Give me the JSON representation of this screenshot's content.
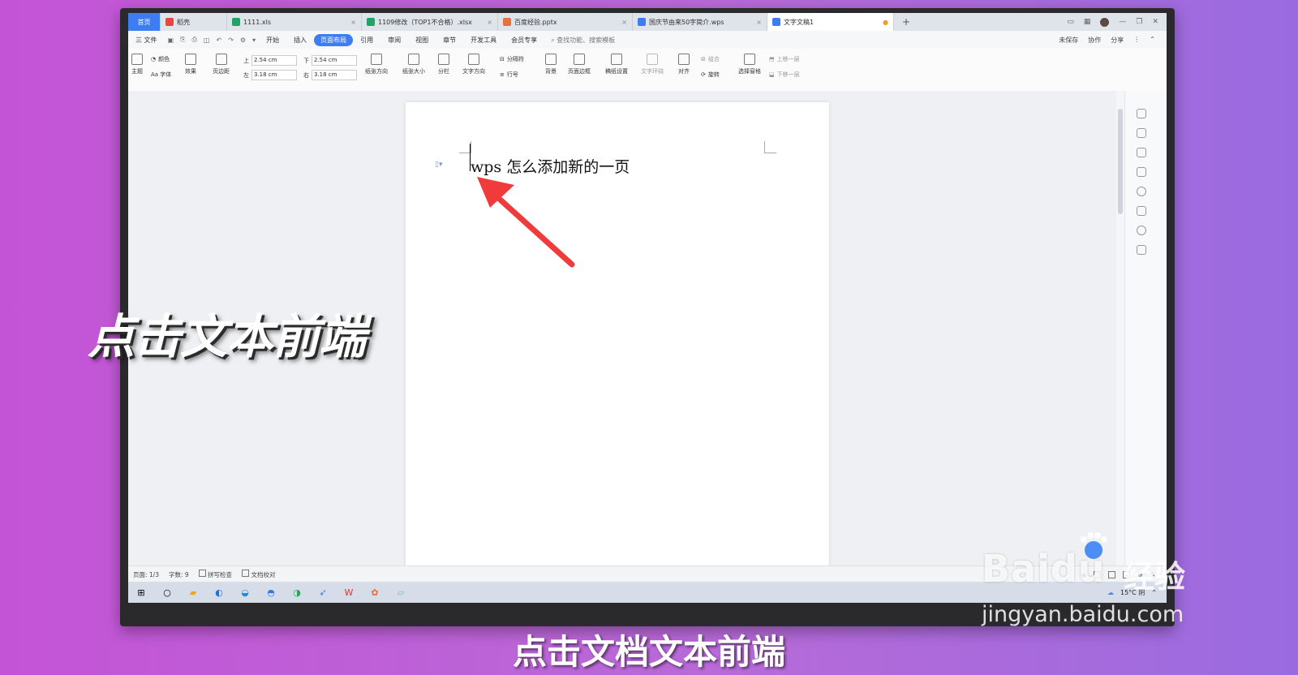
{
  "tabs": [
    {
      "label": "首页",
      "kind": "home"
    },
    {
      "label": "稻壳",
      "color": "#e8453c"
    },
    {
      "label": "1111.xls",
      "color": "#1fa463"
    },
    {
      "label": "1109修改（TOP1不合格）.xlsx",
      "color": "#1fa463"
    },
    {
      "label": "百度经验.pptx",
      "color": "#e8703c"
    },
    {
      "label": "国庆节由来50字简介.wps",
      "color": "#3d7cf3"
    },
    {
      "label": "文字文稿1",
      "color": "#3d7cf3",
      "active": true
    }
  ],
  "tab_add": "+",
  "menu": {
    "file": "三 文件",
    "items": [
      "开始",
      "插入",
      "页面布局",
      "引用",
      "审阅",
      "视图",
      "章节",
      "开发工具",
      "会员专享"
    ],
    "active": "页面布局",
    "search": "查找功能、搜索模板",
    "right": [
      "未保存",
      "协作",
      "分享"
    ]
  },
  "ribbon": {
    "theme": "主题",
    "colors": "颜色",
    "fonts": "Aa 字体",
    "effects": "效果",
    "margins": "页边距",
    "margin_top_label": "上",
    "margin_top": "2.54 cm",
    "margin_bottom_label": "下",
    "margin_bottom": "2.54 cm",
    "margin_left_label": "左",
    "margin_left": "3.18 cm",
    "margin_right_label": "右",
    "margin_right": "3.18 cm",
    "orientation": "纸张方向",
    "size": "纸张大小",
    "columns": "分栏",
    "text_direction": "文字方向",
    "breaks": "分隔符",
    "line_numbers": "行号",
    "background": "背景",
    "page_border": "页面边框",
    "manuscript": "稿纸设置",
    "text_wrap": "文字环绕",
    "align": "对齐",
    "group": "组合",
    "rotate": "旋转",
    "selection_pane": "选择窗格",
    "bring_forward": "上移一层",
    "send_backward": "下移一层"
  },
  "document": {
    "text": "wps 怎么添加新的一页"
  },
  "status": {
    "page": "页面: 1/3",
    "words": "字数: 9",
    "spell": "拼写检查",
    "proof": "文档校对"
  },
  "taskbar": {
    "weather": "15°C 阴"
  },
  "overlay": {
    "caption": "点击文本前端",
    "subtitle": "点击文档文本前端"
  },
  "watermark": {
    "brand": "Baidu",
    "brand_cn": "经验",
    "url": "jingyan.baidu.com"
  },
  "colors": {
    "accent": "#3d7cf3",
    "arrow": "#ef3b3b",
    "background_left": "#c454d6",
    "background_right": "#9a6be0"
  }
}
